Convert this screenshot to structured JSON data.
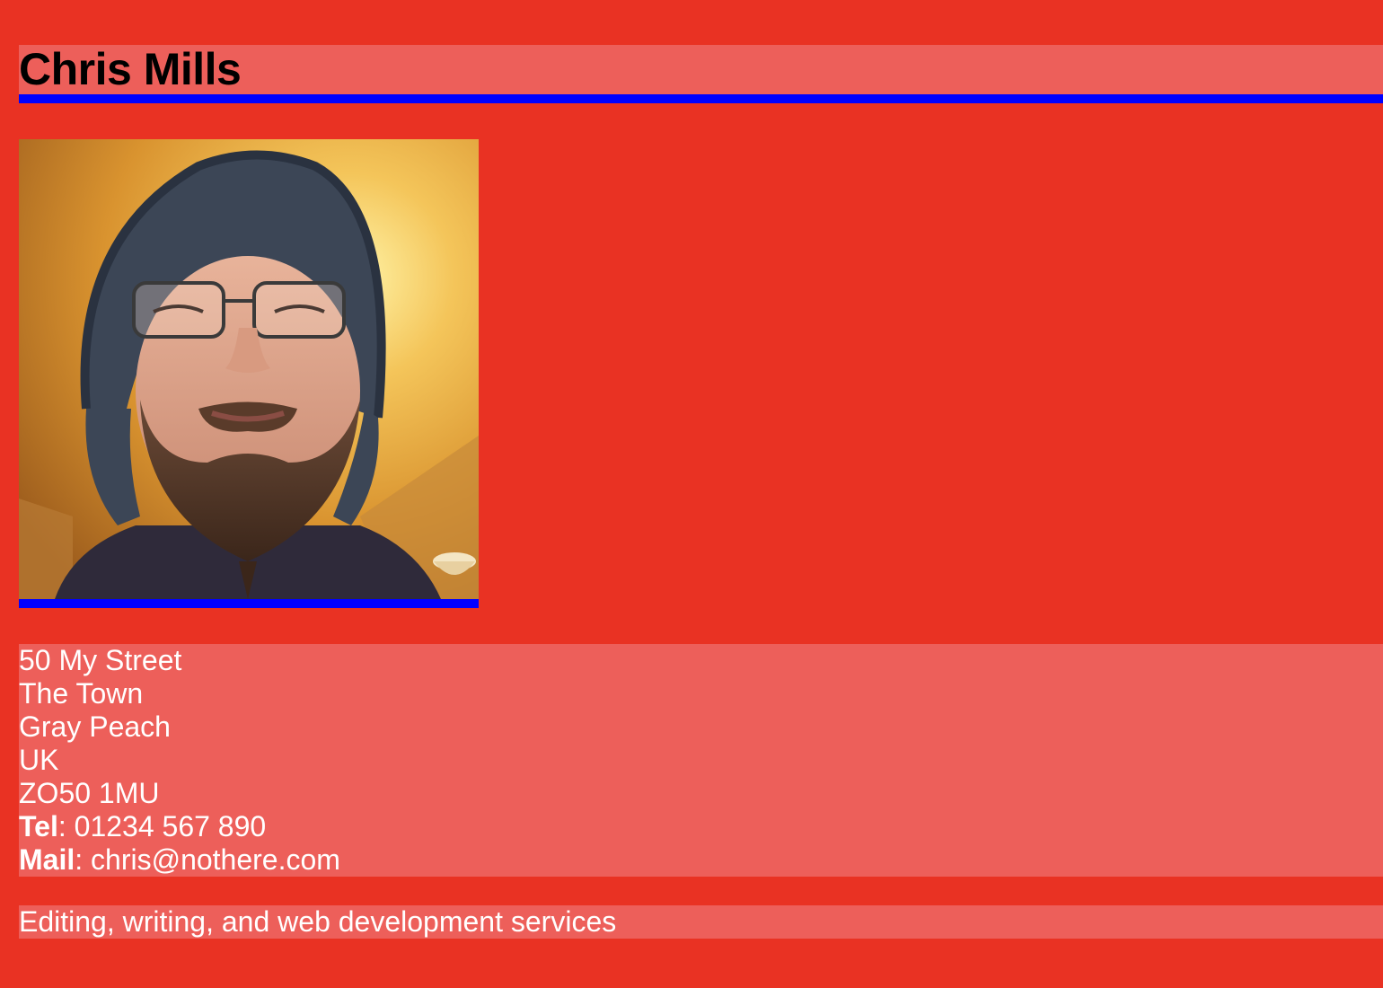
{
  "header": {
    "name": "Chris Mills"
  },
  "photo": {
    "description_icon": "portrait-photo"
  },
  "address": {
    "street": "50 My Street",
    "town": "The Town",
    "county": "Gray Peach",
    "country": "UK",
    "postcode": "ZO50 1MU",
    "tel_label": "Tel",
    "tel_sep": ": ",
    "tel_value": "01234 567 890",
    "mail_label": "Mail",
    "mail_sep": ": ",
    "mail_value": "chris@nothere.com"
  },
  "tagline": {
    "text": "Editing, writing, and web development services"
  },
  "colors": {
    "page_background": "#e93223",
    "box_background": "#ed5f5a",
    "accent_border": "#0000ff"
  }
}
